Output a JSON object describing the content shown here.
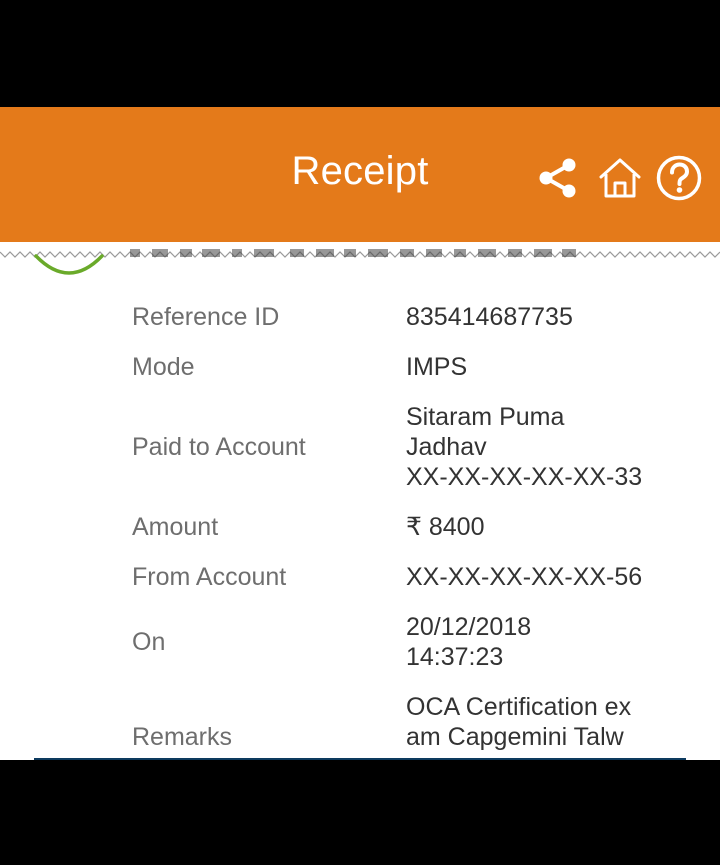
{
  "header": {
    "title": "Receipt",
    "icons": [
      "share-icon",
      "home-icon",
      "help-icon"
    ],
    "background": "#e47a1a"
  },
  "details": {
    "reference": {
      "label": "Reference ID",
      "value": "835414687735"
    },
    "mode": {
      "label": "Mode",
      "value": "IMPS"
    },
    "paid_to": {
      "label": "Paid to Account",
      "lines": [
        "Sitaram Puma",
        "Jadhav",
        "XX-XX-XX-XX-XX-33"
      ]
    },
    "amount": {
      "label": "Amount",
      "value": "₹ 8400"
    },
    "from_account": {
      "label": "From Account",
      "value": "XX-XX-XX-XX-XX-56"
    },
    "on": {
      "label": "On",
      "lines": [
        "20/12/2018",
        "14:37:23"
      ]
    },
    "remarks": {
      "label": "Remarks",
      "lines": [
        "OCA Certification ex",
        "am Capgemini Talw"
      ]
    }
  },
  "colors": {
    "success_green": "#6aaa2a",
    "label_gray": "#6e6e6e",
    "value_dark": "#333333"
  }
}
